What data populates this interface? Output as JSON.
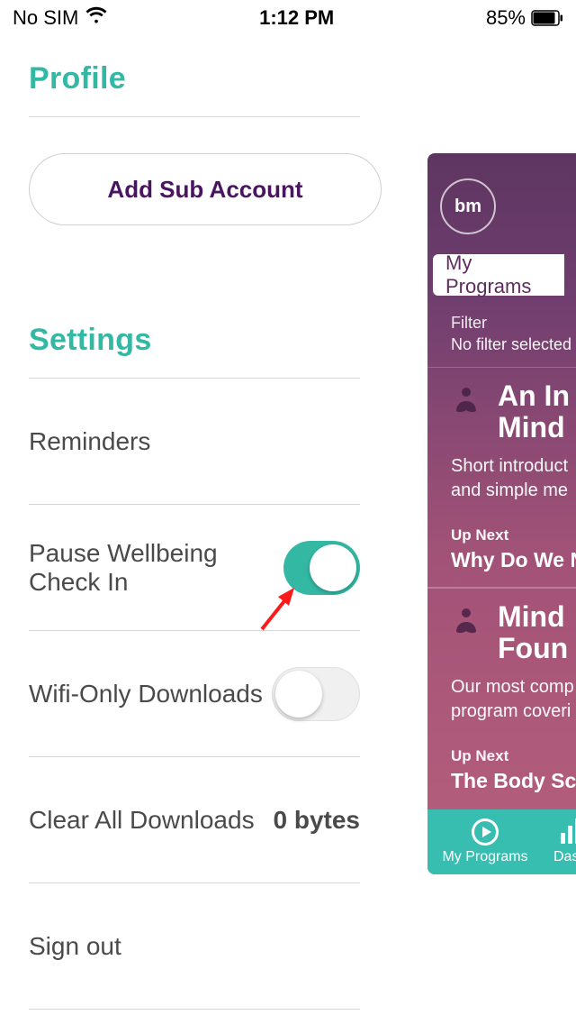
{
  "status": {
    "carrier": "No SIM",
    "time": "1:12 PM",
    "battery_pct": "85%"
  },
  "profile": {
    "heading": "Profile",
    "add_sub_account_label": "Add Sub Account"
  },
  "settings": {
    "heading": "Settings",
    "reminders_label": "Reminders",
    "pause_label": "Pause Wellbeing Check In",
    "pause_on": true,
    "wifi_only_label": "Wifi-Only Downloads",
    "wifi_only_on": false,
    "clear_label": "Clear All Downloads",
    "clear_value": "0 bytes",
    "signout_label": "Sign out"
  },
  "right": {
    "badge": "bm",
    "tab_label": "My Programs",
    "filter_label": "Filter",
    "filter_value": "No filter selected",
    "programs": [
      {
        "title": "An In",
        "title2": "Mind",
        "desc1": "Short introduct",
        "desc2": "and simple me",
        "upnext_label": "Up Next",
        "upnext_title": "Why Do We Ne"
      },
      {
        "title": "Mind",
        "title2": "Foun",
        "desc1": "Our most comp",
        "desc2": "program coveri",
        "upnext_label": "Up Next",
        "upnext_title": "The Body Scar"
      }
    ],
    "tabbar": {
      "my_programs": "My Programs",
      "dashboard": "Dash"
    }
  }
}
